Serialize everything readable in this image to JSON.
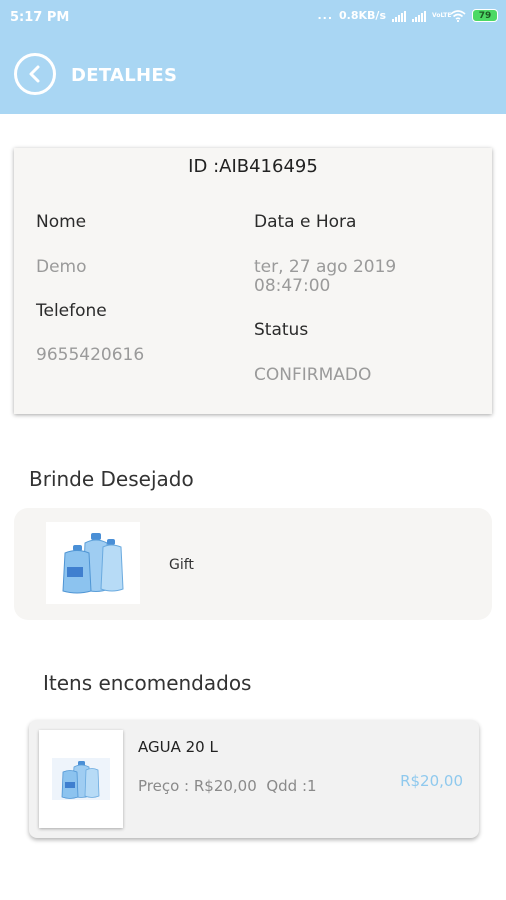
{
  "statusbar": {
    "time": "5:17 PM",
    "dots": "...",
    "network_speed": "0.8KB/s",
    "volte": "VoLTE",
    "battery": "79"
  },
  "header": {
    "title": "DETALHES",
    "back_icon": "chevron-left-circle-icon"
  },
  "order": {
    "id_label": "ID :AIB416495",
    "name_label": "Nome",
    "name_value": "Demo",
    "phone_label": "Telefone",
    "phone_value": "9655420616",
    "datetime_label": "Data e Hora",
    "datetime_line1": "ter, 27 ago 2019",
    "datetime_line2": "08:47:00",
    "status_label": "Status",
    "status_value": "CONFIRMADO"
  },
  "gift_section": {
    "title": "Brinde Desejado",
    "item_name": "Gift",
    "image_icon": "water-bottles-image"
  },
  "items_section": {
    "title": "Itens encomendados",
    "items": [
      {
        "name": "AGUA 20 L",
        "price_label": "Preço : R$20,00",
        "qty_label": "Qdd :1",
        "total": "R$20,00",
        "image_icon": "water-bottles-image"
      }
    ]
  },
  "colors": {
    "header_bg": "#a9d6f3",
    "accent_price": "#8fc9ee",
    "card_bg": "#f7f6f4"
  }
}
